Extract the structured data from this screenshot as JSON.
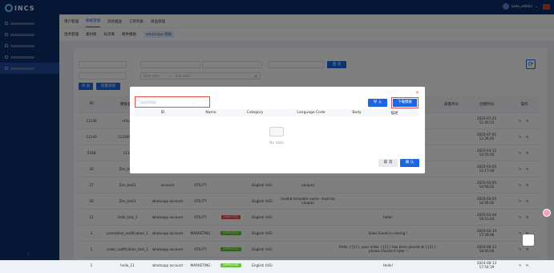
{
  "brand": {
    "name": "INCS"
  },
  "header": {
    "username": "saas_admin",
    "chevron": "⌄"
  },
  "sidebar": {
    "items": [
      {
        "active": false
      },
      {
        "active": false
      },
      {
        "active": false
      },
      {
        "active": false
      },
      {
        "active": true
      }
    ],
    "collapse_icon": "‹"
  },
  "tabs_top": [
    "用户管理",
    "模板管理",
    "消息推送",
    "订单列表",
    "商品管理"
  ],
  "tabs_top_active": 1,
  "tabs_sub": [
    "话术管理",
    "素材库",
    "标识库",
    "邮件模板",
    "whatsapp 模板"
  ],
  "tabs_sub_active": 4,
  "filters": {
    "row1": [
      {
        "placeholder": "",
        "caret": "⌄"
      },
      {
        "placeholder": "",
        "caret": "⌄"
      },
      {
        "placeholder": "",
        "caret": "⌄"
      },
      {
        "placeholder": "",
        "caret": "⌄"
      }
    ],
    "row2_select": {
      "placeholder": "",
      "caret": "⌄"
    },
    "start_date": "Start date",
    "date_sep": "→",
    "end_date": "End date",
    "query_button": "查 询"
  },
  "buttons": {
    "add": "添 加",
    "batch_add": "批量添加"
  },
  "table": {
    "headers": {
      "id": "ID",
      "name": "模板名称",
      "score": "质量评分",
      "created": "创建时间",
      "ops": "操作"
    },
    "rows": [
      {
        "id": "11149",
        "name": "refund",
        "account": "",
        "category": "",
        "status": "",
        "language": "",
        "reason": "",
        "desc": "",
        "created_date": "2025-07-25",
        "created_time": "11:40:13"
      },
      {
        "id": "11140",
        "name": "111000000",
        "account": "",
        "category": "",
        "status": "",
        "language": "",
        "reason": "",
        "desc": "",
        "created_date": "2025-07-01",
        "created_time": "12:26:45"
      },
      {
        "id": "5188",
        "name": "1111",
        "account": "",
        "category": "",
        "status": "",
        "language": "",
        "reason": "",
        "desc": "",
        "created_date": "2025-03-12",
        "created_time": "14:55:05"
      },
      {
        "id": "30",
        "name": "Zen_test4",
        "account": "",
        "category": "",
        "status": "",
        "language": "",
        "reason": "",
        "desc": "",
        "created_date": "2025-03-05",
        "created_time": "15:17:00"
      },
      {
        "id": "27",
        "name": "Zen_test3",
        "account": "account",
        "category": "UTILITY",
        "status": "FAILED",
        "language": "English (US)",
        "reason": "unique)",
        "desc": "",
        "created_date": "2025-03-05",
        "created_time": "14:56:02"
      },
      {
        "id": "26",
        "name": "Zen_test3",
        "account": "whatsapp account",
        "category": "UTILITY",
        "status": "FAILED",
        "language": "English (US)",
        "reason": "Invalid template name: must be unique)",
        "desc": "",
        "created_date": "2025-03-05",
        "created_time": "14:56:02"
      },
      {
        "id": "12",
        "name": "hello_test_1",
        "account": "whatsapp account",
        "category": "UTILITY",
        "status": "REJECTED",
        "language": "English (US)",
        "reason": "",
        "desc": "hello!",
        "created_date": "2025-03-04",
        "created_time": "19:21:01"
      },
      {
        "id": "3",
        "name": "promotion_notification_1",
        "account": "whatsapp account",
        "category": "MARKETING",
        "status": "APPROVED",
        "language": "English (US)",
        "reason": "",
        "desc": "Sales Event is coming !",
        "created_date": "2025-02-19",
        "created_time": "17:39:46"
      },
      {
        "id": "2",
        "name": "order_notification_test_1",
        "account": "whatsapp account",
        "category": "UTILITY",
        "status": "APPROVED",
        "language": "English (US)",
        "reason": "",
        "desc": "Hello {{1}}, your order {{2}} has been placed at {{3}}, please checke it later !",
        "created_date": "2024-08-13",
        "created_time": "18:00:00"
      },
      {
        "id": "1",
        "name": "hello_11",
        "account": "whatsapp account",
        "category": "MARKETING",
        "status": "APPROVED",
        "language": "English (US)",
        "reason": "",
        "desc": "Hello!",
        "created_date": "2024-08-13",
        "created_time": "17:54:39"
      }
    ],
    "ops_icons": "✎ ⟲"
  },
  "modal": {
    "select_placeholder": "请选择模板",
    "select_caret": "⌄",
    "import_button": "导 入",
    "download_button": "下载模板",
    "close": "×",
    "headers": [
      "ID",
      "Name",
      "Category",
      "Language Code",
      "Body",
      "描述"
    ],
    "empty_text": "No data",
    "cancel_button": "取 消",
    "ok_button": "确 认"
  },
  "colors": {
    "primary": "#1c66e3",
    "sidebar": "#0d2c6b",
    "danger": "#e84a4a",
    "success": "#67c23a"
  }
}
